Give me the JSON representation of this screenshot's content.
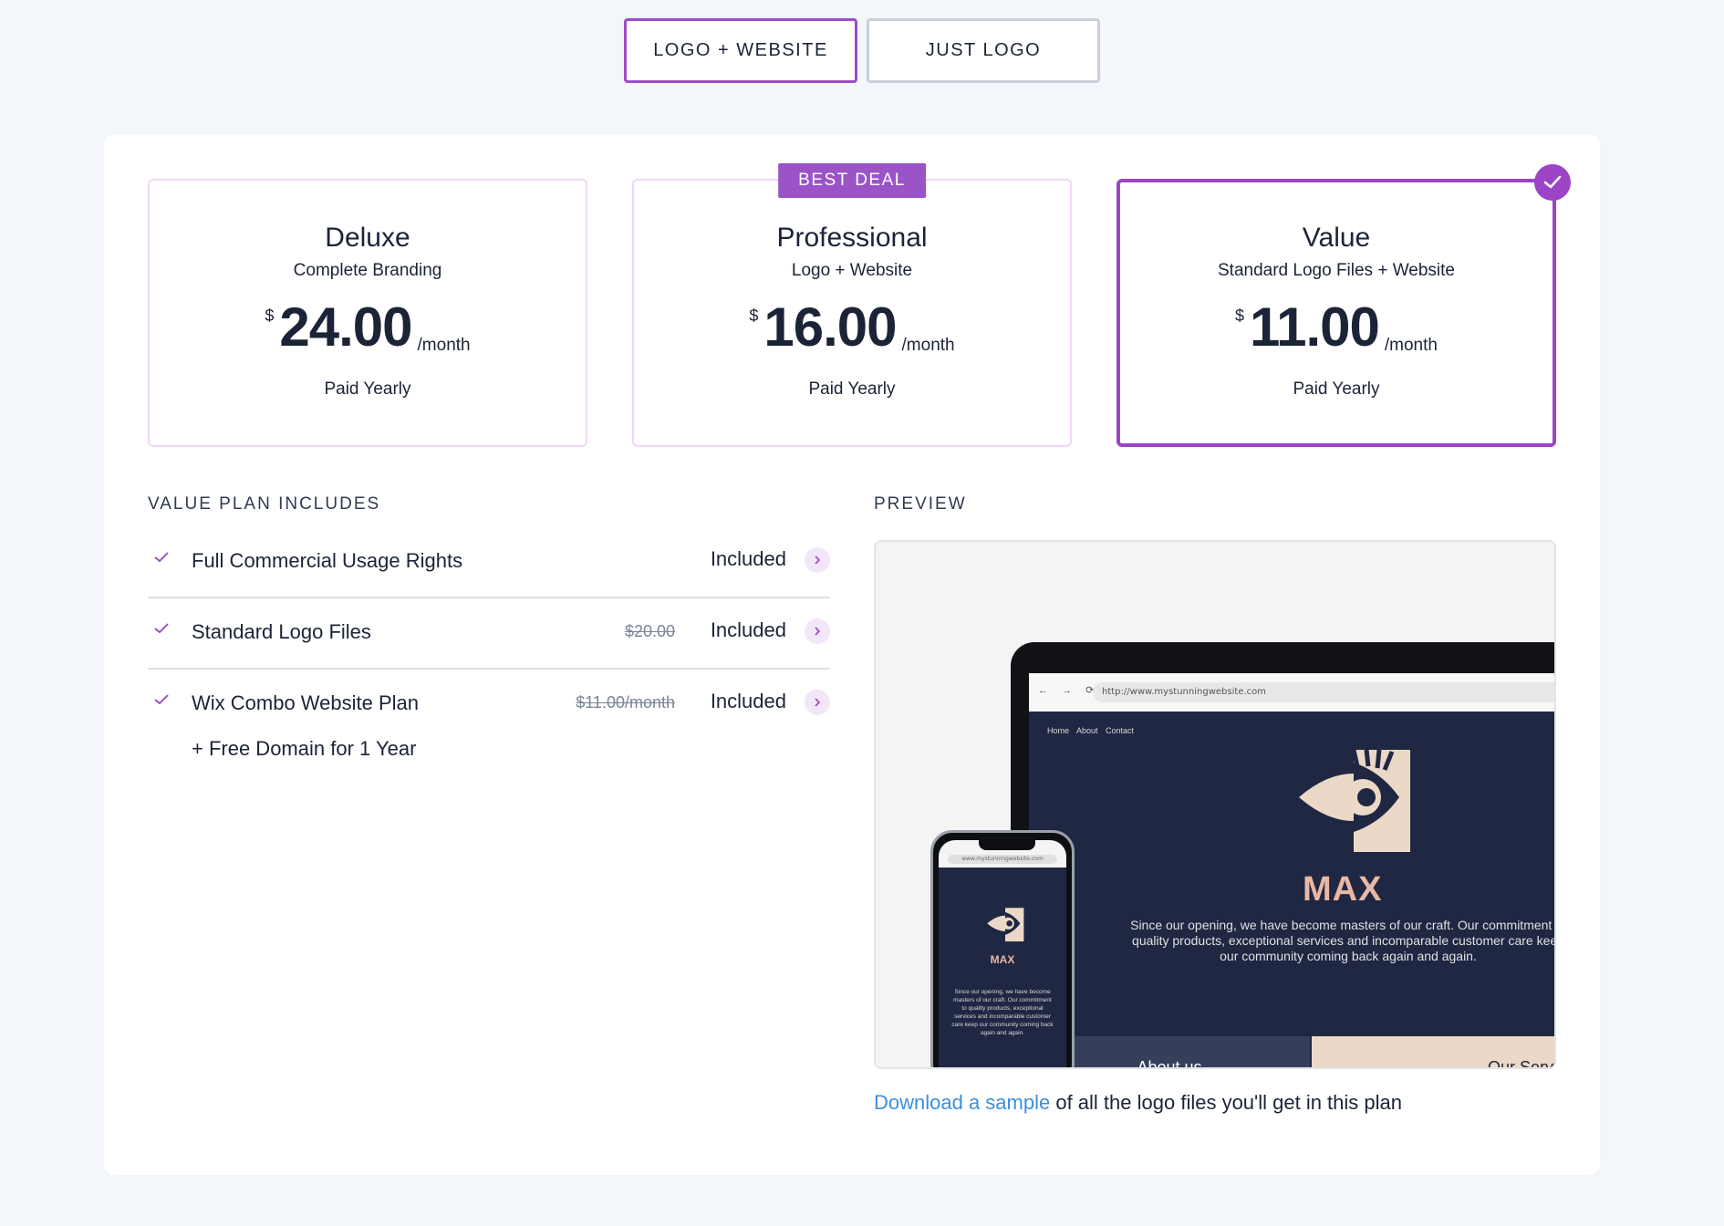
{
  "toggle": {
    "options": [
      {
        "label": "LOGO + WEBSITE",
        "active": true
      },
      {
        "label": "JUST LOGO",
        "active": false
      }
    ]
  },
  "plans": [
    {
      "name": "Deluxe",
      "desc": "Complete Branding",
      "currency": "$",
      "price": "24.00",
      "period": "/month",
      "billing": "Paid Yearly"
    },
    {
      "name": "Professional",
      "desc": "Logo + Website",
      "currency": "$",
      "price": "16.00",
      "period": "/month",
      "billing": "Paid Yearly",
      "badge": "BEST DEAL"
    },
    {
      "name": "Value",
      "desc": "Standard Logo Files + Website",
      "currency": "$",
      "price": "11.00",
      "period": "/month",
      "billing": "Paid Yearly",
      "selected": true
    }
  ],
  "includes": {
    "title": "VALUE PLAN INCLUDES",
    "items": [
      {
        "label": "Full Commercial Usage Rights",
        "old_price": "",
        "status": "Included"
      },
      {
        "label": "Standard Logo Files",
        "old_price": "$20.00",
        "status": "Included"
      },
      {
        "label": "Wix Combo Website Plan",
        "old_price": "$11.00/month",
        "status": "Included",
        "extra": "+ Free Domain for 1 Year"
      }
    ]
  },
  "preview": {
    "title": "PREVIEW",
    "mock": {
      "url": "http://www.mystunningwebsite.com",
      "phone_url": "www.mystunningwebsite.com",
      "nav": "Home About Contact",
      "site_title": "MAX",
      "site_text": "Since our opening, we have become masters of our craft. Our commitment to quality products, exceptional services and incomparable customer care keep our community coming back again and again.",
      "btn_about": "About us",
      "btn_service": "Our Service"
    },
    "download_link": "Download a sample",
    "download_rest": " of all the logo files you'll get in this plan"
  },
  "colors": {
    "accent": "#9b44c6",
    "link": "#3b8fe0",
    "site_bg": "#1f2743",
    "site_title": "#e9b8a4"
  }
}
